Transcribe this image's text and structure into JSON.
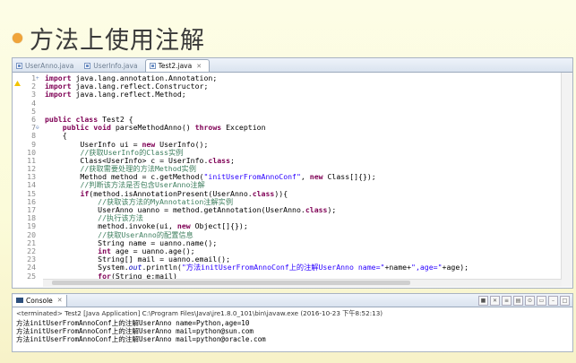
{
  "slide": {
    "title": "方法上使用注解"
  },
  "ide": {
    "tabs": [
      {
        "label": "UserAnno.java"
      },
      {
        "label": "UserInfo.java"
      },
      {
        "label": "Test2.java"
      }
    ],
    "lines": [
      {
        "n": "1",
        "mark": "+",
        "code": "import java.lang.annotation.Annotation;"
      },
      {
        "n": "2",
        "mark": "",
        "code": "import java.lang.reflect.Constructor;"
      },
      {
        "n": "3",
        "mark": "",
        "code": "import java.lang.reflect.Method;"
      },
      {
        "n": "4",
        "mark": "",
        "code": ""
      },
      {
        "n": "5",
        "mark": "",
        "code": ""
      },
      {
        "n": "6",
        "mark": "",
        "code": "public class Test2 {"
      },
      {
        "n": "7",
        "mark": "⊖",
        "code": "    public void parseMethodAnno() throws Exception"
      },
      {
        "n": "8",
        "mark": "",
        "code": "    {"
      },
      {
        "n": "9",
        "mark": "",
        "code": "        UserInfo ui = new UserInfo();"
      },
      {
        "n": "10",
        "mark": "",
        "code": "        //获取UserInfo的Class实例"
      },
      {
        "n": "11",
        "mark": "",
        "code": "        Class<UserInfo> c = UserInfo.class;"
      },
      {
        "n": "12",
        "mark": "",
        "code": "        //获取需要处理的方法Method实例"
      },
      {
        "n": "13",
        "mark": "",
        "code": "        Method method = c.getMethod(\"initUserFromAnnoConf\", new Class[]{});"
      },
      {
        "n": "14",
        "mark": "",
        "code": "        //判断该方法是否包含UserAnno注解"
      },
      {
        "n": "15",
        "mark": "",
        "code": "        if(method.isAnnotationPresent(UserAnno.class)){"
      },
      {
        "n": "16",
        "mark": "",
        "code": "            //获取该方法的MyAnnotation注解实例"
      },
      {
        "n": "17",
        "mark": "",
        "code": "            UserAnno uanno = method.getAnnotation(UserAnno.class);"
      },
      {
        "n": "18",
        "mark": "",
        "code": "            //执行该方法"
      },
      {
        "n": "19",
        "mark": "",
        "code": "            method.invoke(ui, new Object[]{});"
      },
      {
        "n": "20",
        "mark": "",
        "code": "            //获取UserAnno的配置信息"
      },
      {
        "n": "21",
        "mark": "",
        "code": "            String name = uanno.name();"
      },
      {
        "n": "22",
        "mark": "",
        "code": "            int age = uanno.age();"
      },
      {
        "n": "23",
        "mark": "",
        "code": "            String[] mail = uanno.email();"
      },
      {
        "n": "24",
        "mark": "",
        "code": "            System.out.println(\"方法initUserFromAnnoConf上的注解UserAnno name=\"+name+\",age=\"+age);"
      },
      {
        "n": "25",
        "mark": "",
        "code": "            for(String e:mail)"
      }
    ]
  },
  "console": {
    "tab_label": "Console",
    "terminated": "<terminated> Test2 [Java Application] C:\\Program Files\\Java\\jre1.8.0_101\\bin\\javaw.exe (2016-10-23 下午8:52:13)",
    "output": [
      "方法initUserFromAnnoConf上的注解UserAnno name=Python,age=10",
      "方法initUserFromAnnoConf上的注解UserAnno mail=python@sun.com",
      "方法initUserFromAnnoConf上的注解UserAnno mail=python@oracle.com"
    ]
  },
  "colors": {
    "keyword": "#7f0055",
    "comment": "#3f7f5f",
    "string": "#2a00ff",
    "bullet": "#f0a43a"
  }
}
